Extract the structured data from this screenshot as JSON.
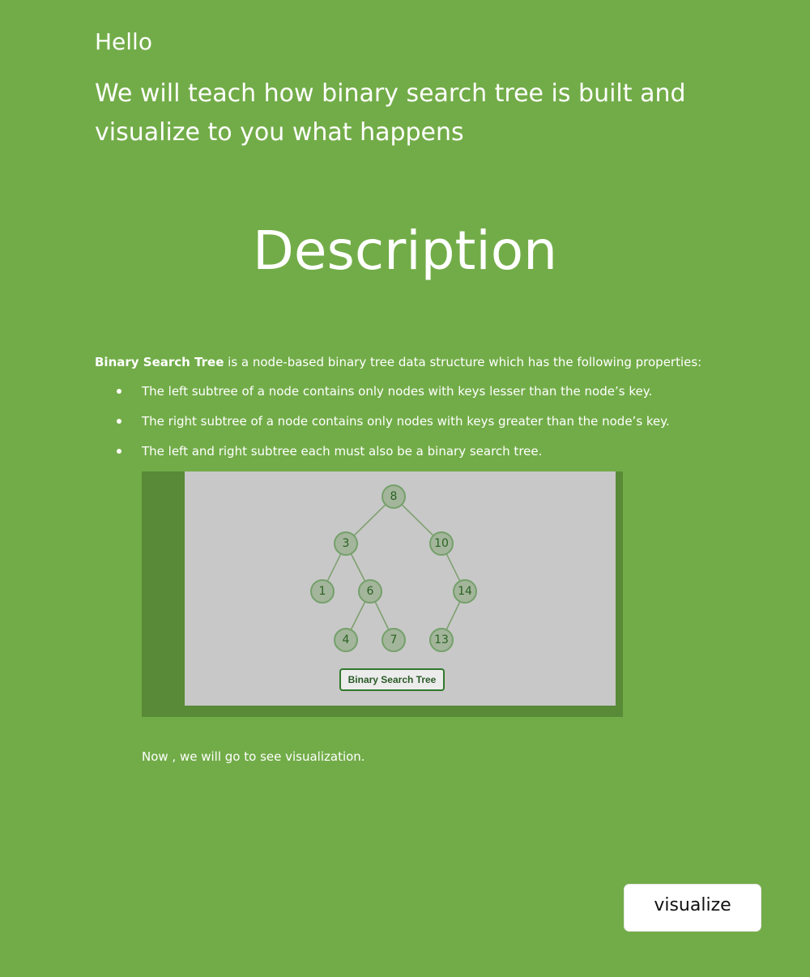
{
  "header": {
    "greeting": "Hello",
    "intro": "We will teach how binary search tree is built and visualize to you what happens"
  },
  "section": {
    "title": "Description"
  },
  "definition": {
    "term": "Binary Search Tree",
    "text": " is a node-based binary tree data structure which has the following properties:"
  },
  "properties": [
    "The left subtree of a node contains only nodes with keys lesser than the node’s key.",
    "The right subtree of a node contains only nodes with keys greater than the node’s key.",
    "The left and right subtree each must also be a binary search tree."
  ],
  "tree_figure": {
    "caption": "Binary Search Tree",
    "nodes": [
      "8",
      "3",
      "10",
      "1",
      "6",
      "14",
      "4",
      "7",
      "13"
    ],
    "edges": [
      [
        "8",
        "3"
      ],
      [
        "8",
        "10"
      ],
      [
        "3",
        "1"
      ],
      [
        "3",
        "6"
      ],
      [
        "10",
        "14"
      ],
      [
        "6",
        "4"
      ],
      [
        "6",
        "7"
      ],
      [
        "14",
        "13"
      ]
    ],
    "colors": {
      "node_fill": "#a3b59b",
      "node_text": "#2a6224",
      "edge": "#7ea06f",
      "background": "#c8c8c8"
    }
  },
  "outro": "Now , we will go to see visualization.",
  "actions": {
    "visualize_label": "visualize"
  },
  "colors": {
    "page_background": "#72ac48",
    "text": "#ffffff"
  }
}
